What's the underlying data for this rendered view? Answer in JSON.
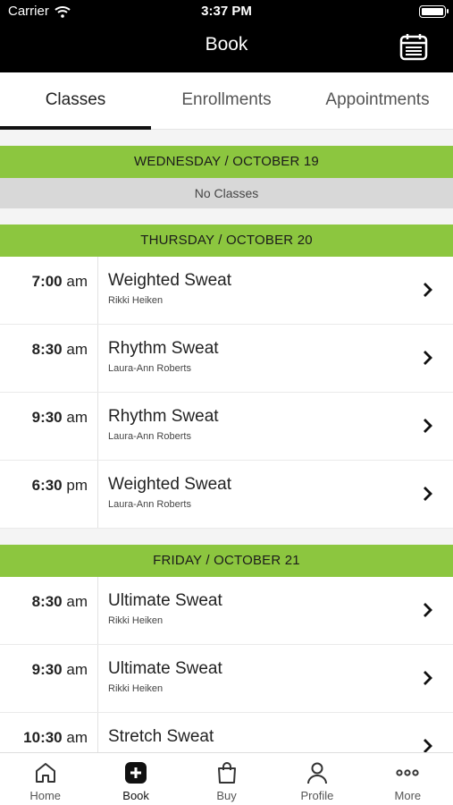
{
  "status_bar": {
    "carrier": "Carrier",
    "time": "3:37 PM"
  },
  "nav": {
    "title": "Book",
    "calendar_icon": "calendar-icon"
  },
  "tabs": [
    {
      "label": "Classes",
      "active": true
    },
    {
      "label": "Enrollments",
      "active": false
    },
    {
      "label": "Appointments",
      "active": false
    }
  ],
  "days": [
    {
      "header": "WEDNESDAY / OCTOBER 19",
      "empty_text": "No Classes",
      "classes": []
    },
    {
      "header": "THURSDAY / OCTOBER 20",
      "classes": [
        {
          "time": "7:00",
          "ampm": "am",
          "name": "Weighted Sweat",
          "instructor": "Rikki Heiken"
        },
        {
          "time": "8:30",
          "ampm": "am",
          "name": "Rhythm Sweat",
          "instructor": "Laura-Ann Roberts"
        },
        {
          "time": "9:30",
          "ampm": "am",
          "name": "Rhythm Sweat",
          "instructor": "Laura-Ann Roberts"
        },
        {
          "time": "6:30",
          "ampm": "pm",
          "name": "Weighted Sweat",
          "instructor": "Laura-Ann Roberts"
        }
      ]
    },
    {
      "header": "FRIDAY / OCTOBER 21",
      "classes": [
        {
          "time": "8:30",
          "ampm": "am",
          "name": "Ultimate Sweat",
          "instructor": "Rikki Heiken"
        },
        {
          "time": "9:30",
          "ampm": "am",
          "name": "Ultimate Sweat",
          "instructor": "Rikki Heiken"
        },
        {
          "time": "10:30",
          "ampm": "am",
          "name": "Stretch Sweat",
          "instructor": ""
        }
      ]
    }
  ],
  "tab_bar": [
    {
      "label": "Home",
      "icon": "home-icon",
      "active": false
    },
    {
      "label": "Book",
      "icon": "plus-square-icon",
      "active": true
    },
    {
      "label": "Buy",
      "icon": "shopping-bag-icon",
      "active": false
    },
    {
      "label": "Profile",
      "icon": "person-icon",
      "active": false
    },
    {
      "label": "More",
      "icon": "more-dots-icon",
      "active": false
    }
  ],
  "colors": {
    "accent_green": "#8cc63f",
    "no_classes_gray": "#d8d8d8",
    "bar_black": "#000000"
  }
}
